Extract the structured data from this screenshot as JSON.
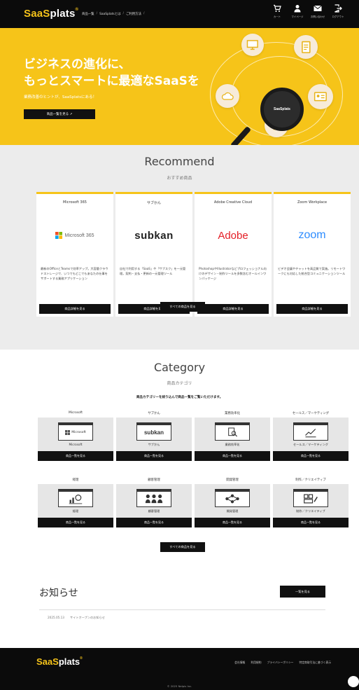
{
  "header": {
    "logo_a": "SaaS",
    "logo_b": "plats",
    "logo_reg": "®",
    "nav": [
      "商品一覧",
      "SaaSplatsとは",
      "ご利用方法"
    ],
    "icons": [
      {
        "name": "cart-icon",
        "label": "カート"
      },
      {
        "name": "mypage-icon",
        "label": "マイページ"
      },
      {
        "name": "mail-icon",
        "label": "お問い合わせ"
      },
      {
        "name": "logout-icon",
        "label": "ログアウト"
      }
    ]
  },
  "hero": {
    "title_line1": "ビジネスの進化に、",
    "title_line2": "もっとスマートに最適なSaaSを",
    "subtitle": "業務改善のヒントが、SaaSplatsにある！",
    "button": "商品一覧を見る ↗",
    "magnifier_label": "SaaSplats"
  },
  "recommend": {
    "title": "Recommend",
    "subtitle": "おすすめ商品",
    "cards": [
      {
        "name": "Microsoft 365",
        "logo": "Microsoft 365",
        "desc": "最新のOfficeとTeamsで効率アップ。大容量クラウドストレージで、いつでもどこでもあなたの仕事をサポートする業務アプリケーション",
        "button": "商品詳細を見る"
      },
      {
        "name": "サブかん",
        "logo": "subkan",
        "desc": "自社で利用する「SaaS」や「サブスク」を一元管理。契約・支払・更新の一元管理ツール",
        "button": "商品詳細を見る"
      },
      {
        "name": "Adobe Creative Cloud",
        "logo": "Adobe",
        "desc": "PhotoshopやIllustratorなどプロフェッショナル向けのデザイン・制作ツールを多数含むオールインワンパッケージ",
        "button": "商品詳細を見る"
      },
      {
        "name": "Zoom Workplace",
        "logo": "zoom",
        "desc": "ビデオ会議やチャットを高品質で実施。リモートワークにも対応した統合型コミュニケーションツール",
        "button": "商品詳細を見る"
      }
    ],
    "all_button": "すべての商品を見る"
  },
  "category": {
    "title": "Category",
    "subtitle": "商品カテゴリ",
    "lead": "商品カテゴリーを絞り込んで商品一覧をご覧いただけます。",
    "items": [
      {
        "label": "Microsoft",
        "caption": "Microsoft",
        "art": "Microsoft",
        "button": "商品一覧を見る"
      },
      {
        "label": "サブかん",
        "caption": "サブかん",
        "art": "subkan",
        "button": "商品一覧を見る"
      },
      {
        "label": "業務効率化",
        "caption": "業務効率化",
        "art": "",
        "button": "商品一覧を見る"
      },
      {
        "label": "セールス／マーケティング",
        "caption": "セールス／マーケティング",
        "art": "",
        "button": "商品一覧を見る"
      },
      {
        "label": "経理",
        "caption": "経理",
        "art": "",
        "button": "商品一覧を見る"
      },
      {
        "label": "顧客管理",
        "caption": "顧客管理",
        "art": "",
        "button": "商品一覧を見る"
      },
      {
        "label": "開発管理",
        "caption": "開発管理",
        "art": "",
        "button": "商品一覧を見る"
      },
      {
        "label": "制作／クリエイティブ",
        "caption": "制作／クリエイティブ",
        "art": "",
        "button": "商品一覧を見る"
      }
    ],
    "all_button": "すべての商品を見る"
  },
  "news": {
    "title": "お知らせ",
    "button": "一覧を見る",
    "items": [
      {
        "date": "2025.05.13",
        "text": "サイトオープンのお知らせ"
      }
    ]
  },
  "footer": {
    "logo_a": "SaaS",
    "logo_b": "plats",
    "logo_reg": "®",
    "links": [
      "会社情報",
      "利用規約",
      "プライバシーポリシー",
      "特定商取引法に基づく表示"
    ],
    "copyright": "© 2025 Nelpis Inc."
  },
  "colors": {
    "brand_yellow": "#f6c419",
    "header_black": "#0b0b0b",
    "section_gray": "#ececec",
    "adobe_red": "#e41e26",
    "zoom_blue": "#2d8cff"
  }
}
